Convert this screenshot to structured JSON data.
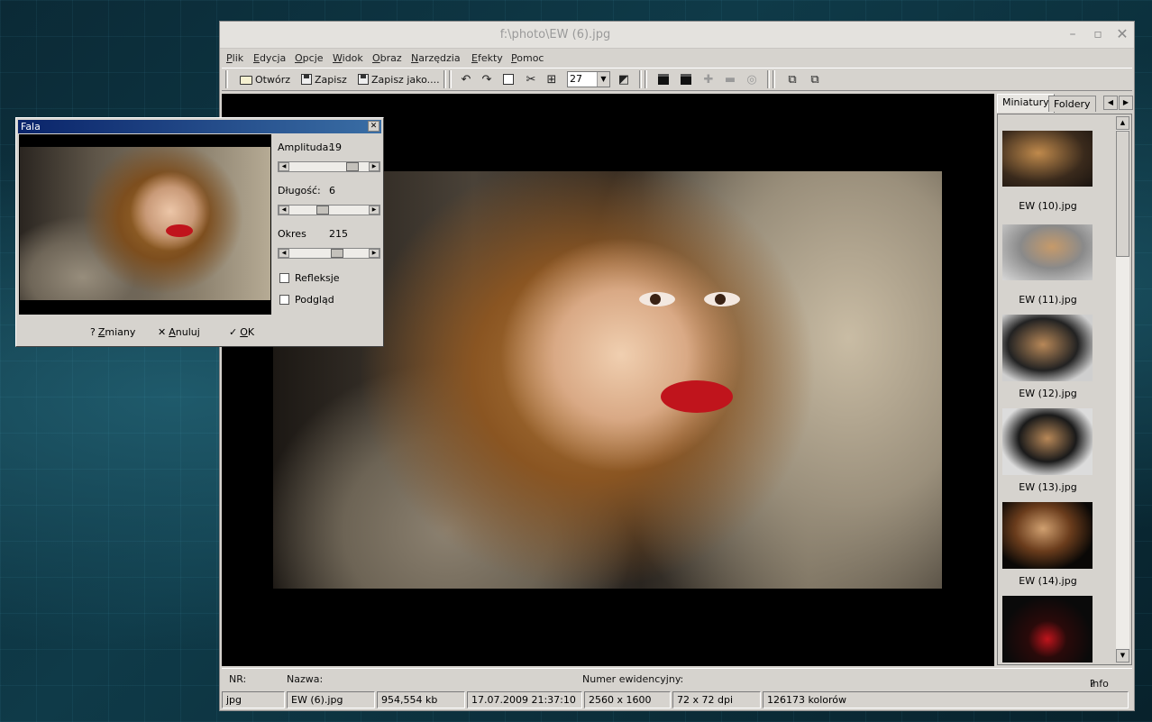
{
  "window": {
    "title": "f:\\photo\\EW (6).jpg"
  },
  "menu": [
    "Plik",
    "Edycja",
    "Opcje",
    "Widok",
    "Obraz",
    "Narzędzia",
    "Efekty",
    "Pomoc"
  ],
  "toolbar": {
    "open_label": "Otwórz",
    "save_label": "Zapisz",
    "save_as_label": "Zapisz jako....",
    "zoom_value": "27"
  },
  "panel": {
    "tabs": [
      "Miniatury",
      "Foldery"
    ],
    "thumbnails": [
      "EW (10).jpg",
      "EW (11).jpg",
      "EW (12).jpg",
      "EW (13).jpg",
      "EW (14).jpg"
    ]
  },
  "infobar": {
    "nr_label": "NR:",
    "name_label": "Nazwa:",
    "evidence_label": "Numer ewidencyjny:",
    "info_button": "Info"
  },
  "status": {
    "format": "jpg",
    "filename": "EW (6).jpg",
    "filesize": "954,554 kb",
    "datetime": "17.07.2009 21:37:10",
    "dimensions": "2560 x 1600",
    "dpi": "72 x 72 dpi",
    "colors": "126173 kolorów"
  },
  "dialog": {
    "title": "Fala",
    "amplitude_label": "Amplituda:",
    "amplitude_value": "19",
    "length_label": "Długość:",
    "length_value": "6",
    "period_label": "Okres",
    "period_value": "215",
    "reflections_label": "Refleksje",
    "preview_label": "Podgląd",
    "changes_button": "Zmiany",
    "cancel_button": "Anuluj",
    "ok_button": "OK",
    "sliders": {
      "amplitude_fraction": 0.85,
      "length_fraction": 0.4,
      "period_fraction": 0.62
    },
    "reflections_checked": false,
    "preview_checked": false
  }
}
